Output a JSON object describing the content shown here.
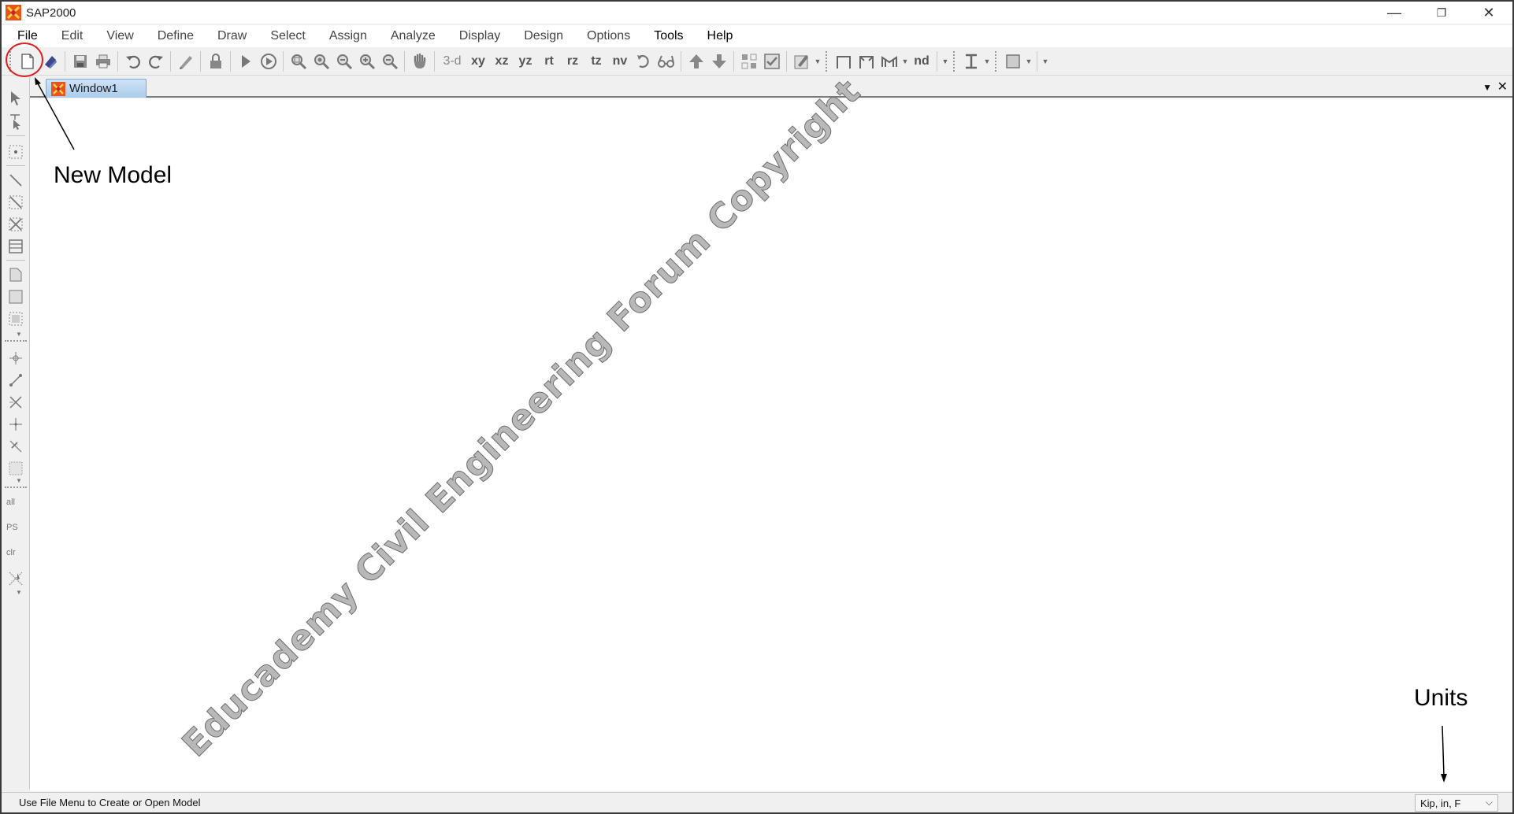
{
  "window": {
    "title": "SAP2000",
    "minimize": "—",
    "restore": "❐",
    "close": "✕"
  },
  "menu": [
    {
      "label": "File",
      "bold": true
    },
    {
      "label": "Edit"
    },
    {
      "label": "View"
    },
    {
      "label": "Define"
    },
    {
      "label": "Draw"
    },
    {
      "label": "Select"
    },
    {
      "label": "Assign"
    },
    {
      "label": "Analyze"
    },
    {
      "label": "Display"
    },
    {
      "label": "Design"
    },
    {
      "label": "Options"
    },
    {
      "label": "Tools",
      "bold": true
    },
    {
      "label": "Help",
      "bold": true
    }
  ],
  "toolbar": {
    "view_3d": "3-d",
    "view_xy": "xy",
    "view_xz": "xz",
    "view_yz": "yz",
    "view_rt": "rt",
    "view_rz": "rz",
    "view_tz": "tz",
    "view_nv": "nv",
    "nd": "nd"
  },
  "left_toolbar": {
    "all": "all",
    "ps": "PS",
    "clr": "clr"
  },
  "document_tab": {
    "label": "Window1"
  },
  "watermark": "Educademy Civil Engineering Forum Copyright",
  "annotations": {
    "new_model": "New Model",
    "units": "Units"
  },
  "status_bar": {
    "message": "Use File Menu to Create or Open Model",
    "units": "Kip, in, F"
  },
  "colors": {
    "annotation_circle": "#e02020",
    "tab_active": "#a9cbeb",
    "app_icon_bg": "#e8541c"
  }
}
